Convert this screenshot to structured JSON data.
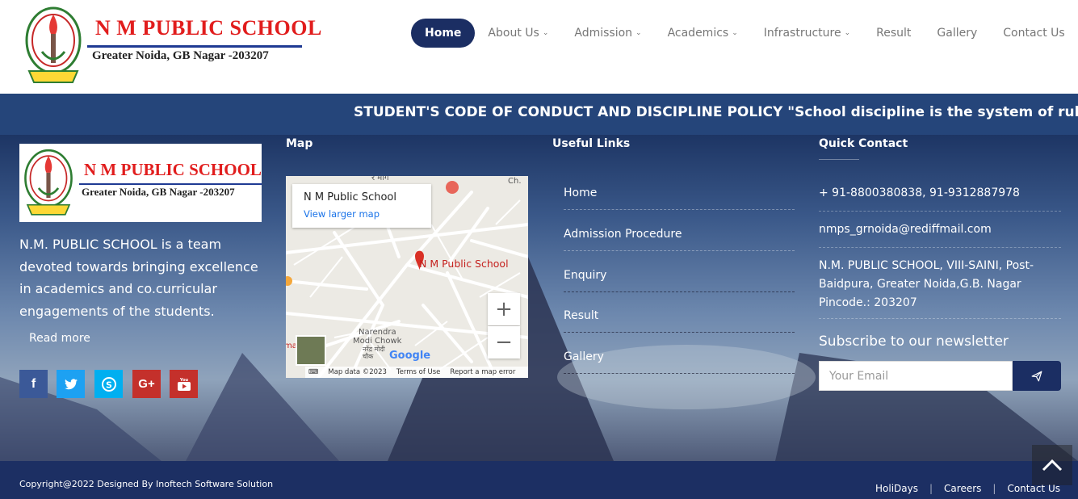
{
  "header": {
    "school_name": "N M PUBLIC SCHOOL",
    "address": "Greater Noida, GB Nagar -203207",
    "nav": [
      {
        "label": "Home",
        "active": true
      },
      {
        "label": "About Us",
        "dropdown": true
      },
      {
        "label": "Admission",
        "dropdown": true
      },
      {
        "label": "Academics",
        "dropdown": true
      },
      {
        "label": "Infrastructure",
        "dropdown": true
      },
      {
        "label": "Result"
      },
      {
        "label": "Gallery"
      },
      {
        "label": "Contact Us"
      }
    ],
    "chevron": "⌄"
  },
  "marquee": {
    "text": "STUDENT'S CODE OF CONDUCT AND DISCIPLINE POLICY \"School discipline is the system of rules, puni"
  },
  "footer": {
    "logo": {
      "school_name": "N M PUBLIC SCHOOL",
      "address": "Greater Noida, GB Nagar -203207"
    },
    "about": "N.M. PUBLIC SCHOOL is a team devoted towards bringing excellence in academics and co.curricular engagements of the students.",
    "read_more": "Read more",
    "social": [
      {
        "icon": "facebook-icon",
        "glyph": "f",
        "color": "#3b5998"
      },
      {
        "icon": "twitter-icon",
        "glyph": "t",
        "color": "#1da1f2"
      },
      {
        "icon": "skype-icon",
        "glyph": "S",
        "color": "#00aff0"
      },
      {
        "icon": "google-plus-icon",
        "glyph": "G+",
        "color": "#c4302b"
      },
      {
        "icon": "youtube-icon",
        "glyph": "▶",
        "color": "#c4302b"
      }
    ],
    "map_heading": "Map",
    "map": {
      "place": "N M Public School",
      "link": "View larger map",
      "pin_label": "N M Public School",
      "label_ch": "Ch.",
      "label_narendra": "Narendra",
      "label_modi": "Modi Chowk",
      "label_hindi": "नरेंद्र मोदी चौक",
      "label_hindi_top": "र मार्ग",
      "label_ma": "ma",
      "google": "Google",
      "zoom_in": "+",
      "zoom_out": "−",
      "footer_items": [
        "Map data ©2023",
        "Terms of Use",
        "Report a map error"
      ]
    },
    "useful_links_heading": "Useful Links",
    "useful_links": [
      "Home",
      "Admission Procedure",
      "Enquiry",
      "Result",
      "Gallery"
    ],
    "quick_contact_heading": "Quick Contact",
    "phone": "+ 91-8800380838, 91-9312887978",
    "email": "nmps_grnoida@rediffmail.com",
    "address": "N.M. PUBLIC SCHOOL, VIII-SAINI, Post-Baidpura, Greater Noida,G.B. Nagar Pincode.: 203207",
    "newsletter_heading": "Subscribe to our newsletter",
    "email_placeholder": "Your Email"
  },
  "bottom": {
    "copyright": "Copyright@2022 Designed By Inoftech Software Solution",
    "links": [
      "HoliDays",
      "Careers",
      "Contact Us"
    ]
  },
  "colors": {
    "brand_navy": "#1b2e63",
    "brand_red": "#e11d1d",
    "marquee_bg": "#25457a"
  }
}
